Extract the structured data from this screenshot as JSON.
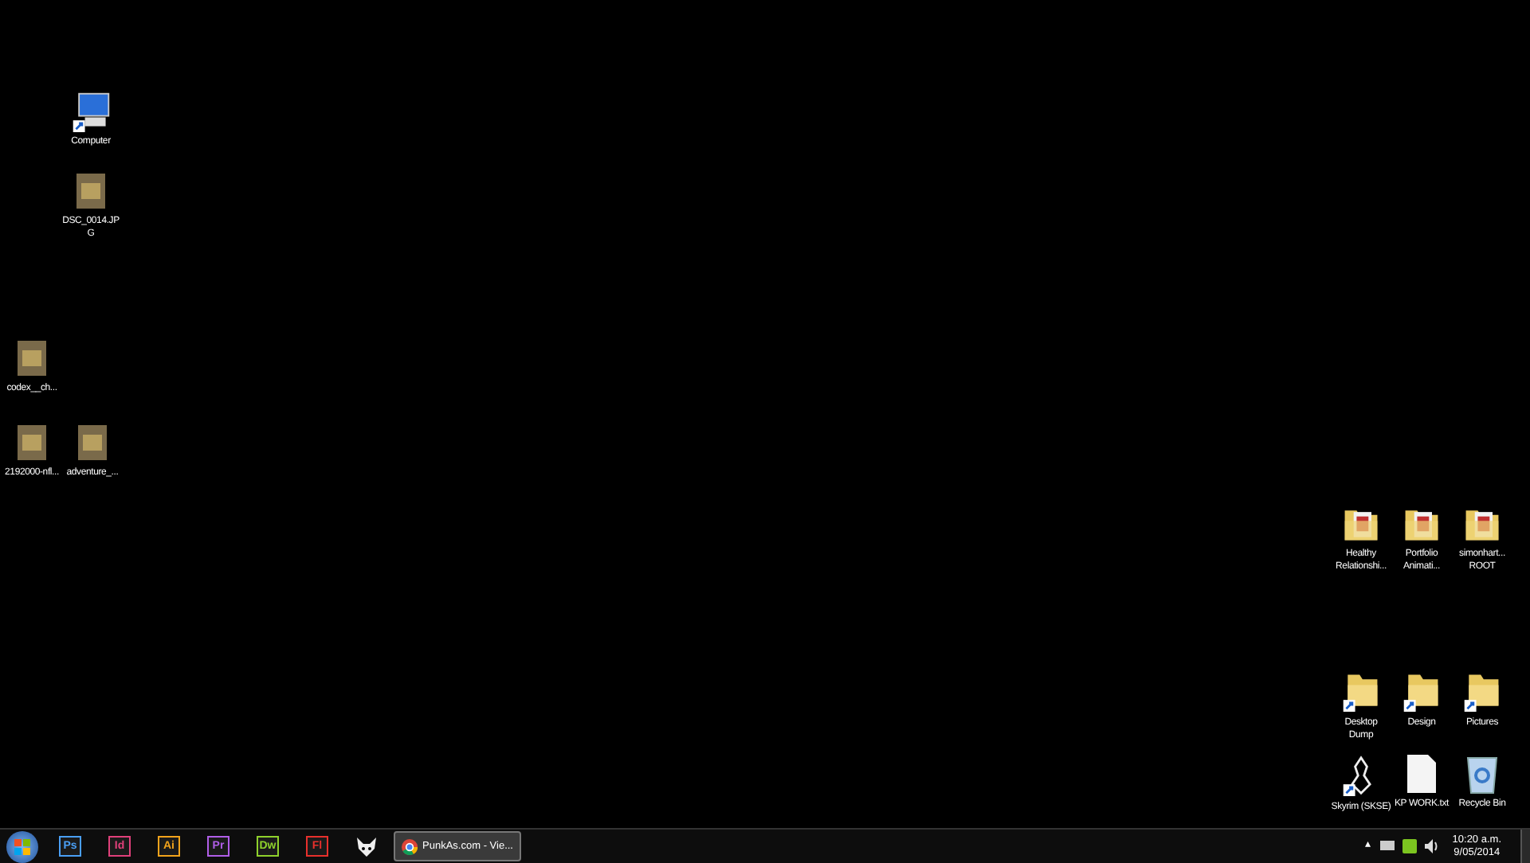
{
  "desktop_icons": [
    {
      "kind": "computer",
      "label": "Computer"
    },
    {
      "kind": "image",
      "label": "DSC_0014.JP\nG"
    },
    {
      "kind": "image",
      "label": "codex__ch..."
    },
    {
      "kind": "image",
      "label": "2192000-nfl..."
    },
    {
      "kind": "image",
      "label": "adventure_..."
    },
    {
      "kind": "folder",
      "label": "Healthy\nRelationshi..."
    },
    {
      "kind": "folder",
      "label": "Portfolio\nAnimati..."
    },
    {
      "kind": "folder",
      "label": "simonhart...\nROOT"
    },
    {
      "kind": "folder-shortcut",
      "label": "Desktop\nDump"
    },
    {
      "kind": "folder-shortcut",
      "label": "Design"
    },
    {
      "kind": "folder-shortcut",
      "label": "Pictures"
    },
    {
      "kind": "game-shortcut",
      "label": "Skyrim (SKSE)"
    },
    {
      "kind": "text-file",
      "label": "KP WORK.txt"
    },
    {
      "kind": "recycle-bin",
      "label": "Recycle Bin"
    }
  ],
  "taskbar": {
    "pinned": [
      {
        "kind": "app",
        "label": "Ps",
        "color": "#4a9ff5"
      },
      {
        "kind": "app",
        "label": "Id",
        "color": "#e0407a"
      },
      {
        "kind": "app",
        "label": "Ai",
        "color": "#f2a31b"
      },
      {
        "kind": "app",
        "label": "Pr",
        "color": "#b05ee8"
      },
      {
        "kind": "app",
        "label": "Dw",
        "color": "#8fd12c"
      },
      {
        "kind": "app",
        "label": "Fl",
        "color": "#e8302c"
      },
      {
        "kind": "fox"
      }
    ],
    "open_window": {
      "title": "PunkAs.com - Vie...",
      "selected": true
    },
    "tray": {
      "expand": "▴",
      "time": "10:20 a.m.",
      "date": "9/05/2014"
    }
  }
}
